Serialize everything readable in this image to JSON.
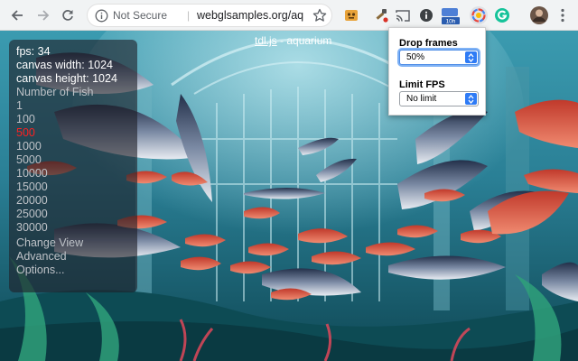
{
  "browser": {
    "security_label": "Not Secure",
    "url": "webglsamples.org/aq",
    "ext_badge": "10h",
    "icons": [
      "back-arrow-icon",
      "forward-arrow-icon",
      "reload-icon",
      "info-icon",
      "star-icon",
      "cast-icon",
      "profile-avatar"
    ],
    "accent": "#1a73e8"
  },
  "page": {
    "title_link": "tdl.js",
    "title_rest": " - aquarium"
  },
  "stats": {
    "fps": "fps: 34",
    "canvas_width": "canvas width: 1024",
    "canvas_height": "canvas height: 1024"
  },
  "menu": {
    "heading": "Number of Fish",
    "fish_counts": [
      "1",
      "100",
      "500",
      "1000",
      "5000",
      "10000",
      "15000",
      "20000",
      "25000",
      "30000"
    ],
    "selected": "500",
    "selected_color": "#ff2020",
    "links": [
      "Change View",
      "Advanced",
      "Options..."
    ]
  },
  "popup": {
    "drop_label": "Drop frames",
    "drop_value": "50%",
    "limit_label": "Limit FPS",
    "limit_value": "No limit"
  }
}
